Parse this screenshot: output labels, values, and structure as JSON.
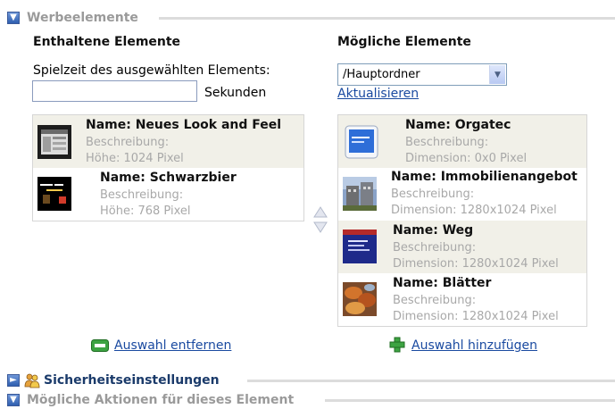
{
  "sections": {
    "werbe": {
      "title": "Werbeelemente"
    },
    "sicherheit": {
      "title": "Sicherheitseinstellungen"
    },
    "aktionen": {
      "title": "Mögliche Aktionen für dieses Element"
    }
  },
  "left": {
    "heading": "Enthaltene Elemente",
    "playtime_label": "Spielzeit des ausgewählten Elements:",
    "playtime_value": "",
    "unit": "Sekunden",
    "items": [
      {
        "name": "Name: Neues Look and Feel",
        "desc": "Beschreibung:",
        "dim": "Höhe: 1024 Pixel"
      },
      {
        "name": "Name: Schwarzbier",
        "desc": "Beschreibung:",
        "dim": "Höhe: 768 Pixel"
      }
    ],
    "remove_label": "Auswahl entfernen"
  },
  "right": {
    "heading": "Mögliche Elemente",
    "folder": "/Hauptordner",
    "refresh_label": "Aktualisieren",
    "items": [
      {
        "name": "Name: Orgatec",
        "desc": "Beschreibung:",
        "dim": "Dimension: 0x0 Pixel"
      },
      {
        "name": "Name: Immobilienangebot",
        "desc": "Beschreibung:",
        "dim": "Dimension: 1280x1024 Pixel"
      },
      {
        "name": "Name: Weg",
        "desc": "Beschreibung:",
        "dim": "Dimension: 1280x1024 Pixel"
      },
      {
        "name": "Name: Blätter",
        "desc": "Beschreibung:",
        "dim": "Dimension: 1280x1024 Pixel"
      }
    ],
    "add_label": "Auswahl hinzufügen"
  }
}
